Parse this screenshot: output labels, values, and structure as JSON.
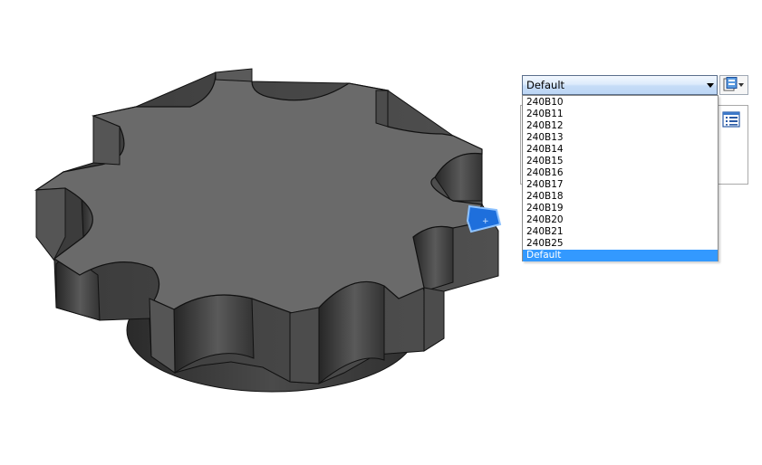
{
  "config_selector": {
    "current_value": "Default",
    "options": [
      {
        "label": "240B10",
        "selected": false
      },
      {
        "label": "240B11",
        "selected": false
      },
      {
        "label": "240B12",
        "selected": false
      },
      {
        "label": "240B13",
        "selected": false
      },
      {
        "label": "240B14",
        "selected": false
      },
      {
        "label": "240B15",
        "selected": false
      },
      {
        "label": "240B16",
        "selected": false
      },
      {
        "label": "240B17",
        "selected": false
      },
      {
        "label": "240B18",
        "selected": false
      },
      {
        "label": "240B19",
        "selected": false
      },
      {
        "label": "240B20",
        "selected": false
      },
      {
        "label": "240B21",
        "selected": false
      },
      {
        "label": "240B25",
        "selected": false
      },
      {
        "label": "Default",
        "selected": true
      }
    ]
  },
  "icons": {
    "split_button": "configuration-icon",
    "panel": "property-list-icon",
    "model": "sprocket-model",
    "selection": "selected-face-icon"
  },
  "colors": {
    "selection_highlight": "#3399ff",
    "model_face": "#6a6a6a",
    "selected_face": "#1e6fdc"
  }
}
